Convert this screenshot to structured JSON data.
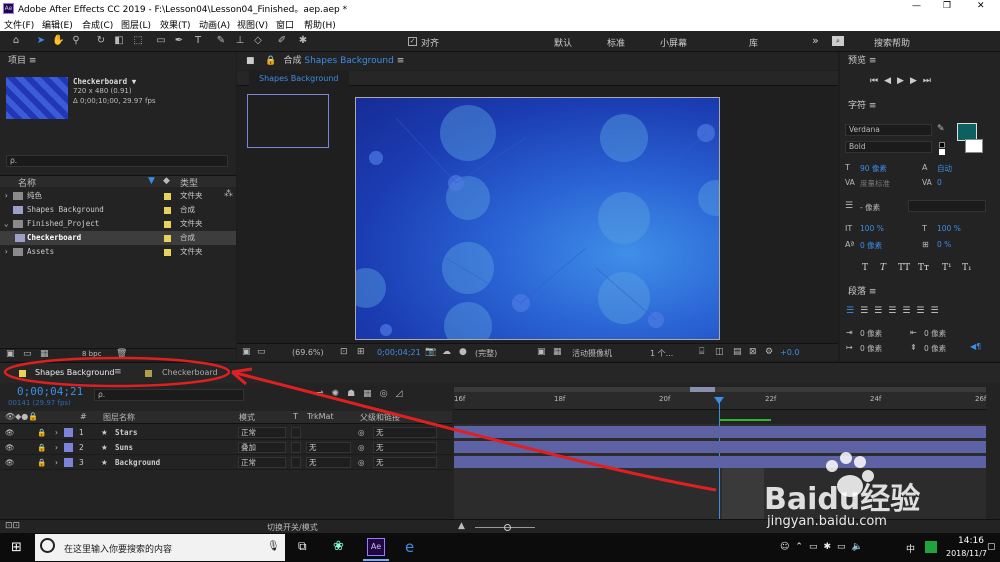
{
  "app": {
    "title": "Adobe After Effects CC 2019 - F:\\Lesson04\\Lesson04_Finished。aep.aep *",
    "icon": "ae-logo-icon"
  },
  "window_controls": {
    "minimize": "—",
    "maximize": "❐",
    "close": "✕"
  },
  "menu": [
    "文件(F)",
    "编辑(E)",
    "合成(C)",
    "图层(L)",
    "效果(T)",
    "动画(A)",
    "视图(V)",
    "窗口",
    "帮助(H)"
  ],
  "toolbar": {
    "snap_label": "对齐",
    "workspaces": [
      "默认",
      "标准",
      "小屏幕",
      "库"
    ],
    "expand": "»",
    "search_placeholder": "搜索帮助"
  },
  "project": {
    "title": "项目",
    "selected_name": "Checkerboard ▼",
    "selected_size": "720 x 480 (0.91)",
    "selected_duration": "Δ 0;00;10;00, 29.97 fps",
    "search_placeholder": "ρ.",
    "col_name": "名称",
    "col_type": "类型",
    "items": [
      {
        "name": "纯色",
        "type": "文件夹",
        "kind": "folder",
        "color": "#e8d35a",
        "indent": 0
      },
      {
        "name": "Shapes Background",
        "type": "合成",
        "kind": "comp",
        "color": "#e8d35a",
        "indent": 0
      },
      {
        "name": "Finished_Project",
        "type": "文件夹",
        "kind": "folder",
        "color": "#e8d35a",
        "indent": 0
      },
      {
        "name": "Checkerboard",
        "type": "合成",
        "kind": "comp",
        "color": "#e8d35a",
        "indent": 1
      },
      {
        "name": "Assets",
        "type": "文件夹",
        "kind": "folder",
        "color": "#e8d35a",
        "indent": 0
      }
    ],
    "bpc": "8 bpc"
  },
  "composition": {
    "panel_label": "合成",
    "comp_name": "Shapes Background",
    "tab": "Shapes Background",
    "zoom": "(69.6%)",
    "timecode": "0;00;04;21",
    "resolution": "(完整)",
    "camera": "活动摄像机",
    "views": "1 个...",
    "exposure": "+0.0"
  },
  "preview": {
    "title": "预览"
  },
  "character": {
    "title": "字符",
    "font": "Verdana",
    "style": "Bold",
    "size": "90 像素",
    "leading": "自动",
    "kerning": "度量标准",
    "tracking": "0",
    "stroke_width": "- 像素",
    "v_scale": "100 %",
    "h_scale": "100 %",
    "baseline": "0 像素",
    "tsume": "0 %",
    "styles": [
      "T",
      "T",
      "TT",
      "Tт",
      "T¹",
      "T₁"
    ]
  },
  "paragraph": {
    "title": "段落",
    "indent_left": "0 像素",
    "indent_first": "0 像素",
    "indent_right": "0 像素",
    "space_before": "0 像素",
    "space_after": "0 像素"
  },
  "timeline": {
    "tabs": [
      "Shapes Background",
      "Checkerboard"
    ],
    "timecode": "0;00;04;21",
    "frame_info": "00141 (29.97 fps)",
    "search_placeholder": "ρ.",
    "cols": {
      "num": "#",
      "name": "图层名称",
      "mode": "模式",
      "t": "T",
      "trkmat": "TrkMat",
      "parent": "父级和链接"
    },
    "layers": [
      {
        "num": "1",
        "name": "Stars",
        "mode": "正常",
        "trkmat": "",
        "parent": "无",
        "color": "#7b84d9"
      },
      {
        "num": "2",
        "name": "Suns",
        "mode": "叠加",
        "trkmat": "无",
        "parent": "无",
        "color": "#7b84d9"
      },
      {
        "num": "3",
        "name": "Background",
        "mode": "正常",
        "trkmat": "无",
        "parent": "无",
        "color": "#7b84d9"
      }
    ],
    "ruler": [
      "16f",
      "18f",
      "20f",
      "22f",
      "24f",
      "26f"
    ],
    "toggle_label": "切换开关/模式"
  },
  "taskbar": {
    "search_placeholder": "在这里输入你要搜索的内容",
    "time": "14:16",
    "date": "2018/11/7",
    "ime": "中"
  },
  "watermark": {
    "brand": "Baidu经验",
    "url": "jingyan.baidu.com"
  },
  "colors": {
    "accent": "#2d8ceb",
    "annotation": "#e02020",
    "comp_blue": "#1d3fb8"
  }
}
